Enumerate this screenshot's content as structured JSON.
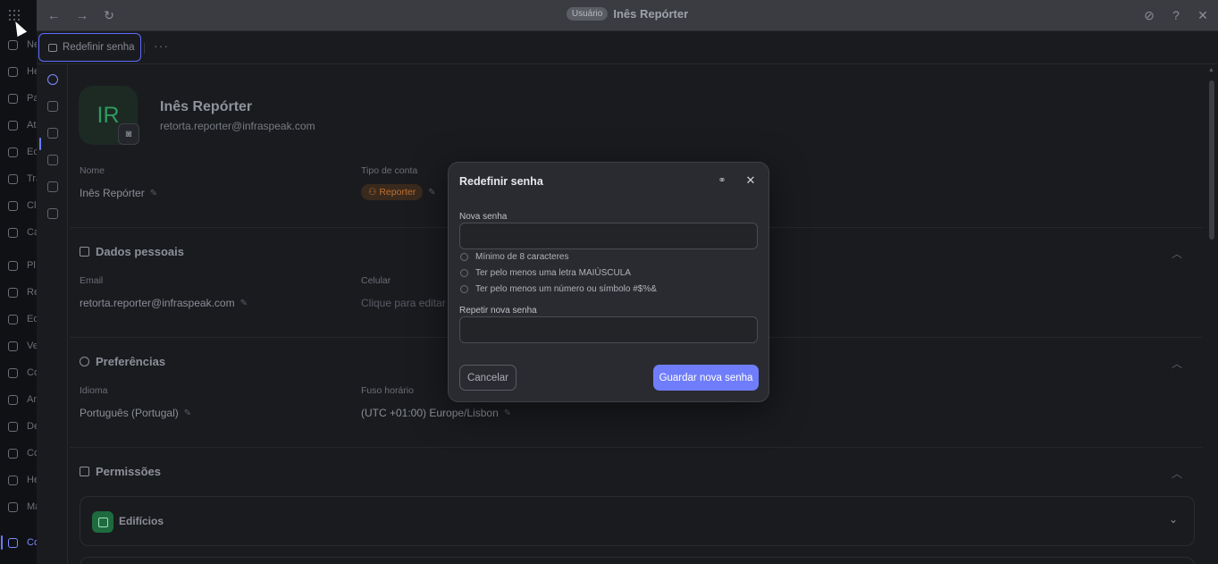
{
  "app_nav": {
    "items": [
      "Ne",
      "He",
      "Pa",
      "At",
      "Ec",
      "Tra",
      "Cl",
      "Ca",
      "Pl",
      "Re",
      "Eq",
      "Ve",
      "Co",
      "An",
      "De",
      "Co",
      "He",
      "Ma",
      "Co"
    ]
  },
  "topbar": {
    "badge": "Usuário",
    "title": "Inês Repórter",
    "back_icon": "←",
    "forward_icon": "→",
    "refresh_icon": "↻",
    "link_icon": "⊘",
    "help_icon": "?",
    "close_icon": "✕"
  },
  "tabbar": {
    "active_tab": "Redefinir senha",
    "more": "···"
  },
  "profile": {
    "initials": "IR",
    "name": "Inês Repórter",
    "email": "retorta.reporter@infraspeak.com"
  },
  "fields": {
    "nome_label": "Nome",
    "nome_value": "Inês Repórter",
    "tipo_label": "Tipo de conta",
    "tipo_value": "Reporter"
  },
  "sections": {
    "dados_pessoais": {
      "title": "Dados pessoais",
      "email_label": "Email",
      "email_value": "retorta.reporter@infraspeak.com",
      "celular_label": "Celular",
      "celular_placeholder": "Clique para editar"
    },
    "preferencias": {
      "title": "Preferências",
      "idioma_label": "Idioma",
      "idioma_value": "Português (Portugal)",
      "fuso_label": "Fuso horário",
      "fuso_value": "(UTC +01:00) Europe/Lisbon"
    },
    "permissoes": {
      "title": "Permissões",
      "card_label": "Edifícios"
    }
  },
  "modal": {
    "title": "Redefinir senha",
    "new_password_label": "Nova senha",
    "new_password_value": "",
    "rules": [
      "Mínimo de 8 caracteres",
      "Ter pelo menos uma letra MAIÚSCULA",
      "Ter pelo menos um número ou símbolo #$%&"
    ],
    "repeat_password_label": "Repetir nova senha",
    "repeat_password_value": "",
    "cancel_label": "Cancelar",
    "save_label": "Guardar nova senha"
  }
}
